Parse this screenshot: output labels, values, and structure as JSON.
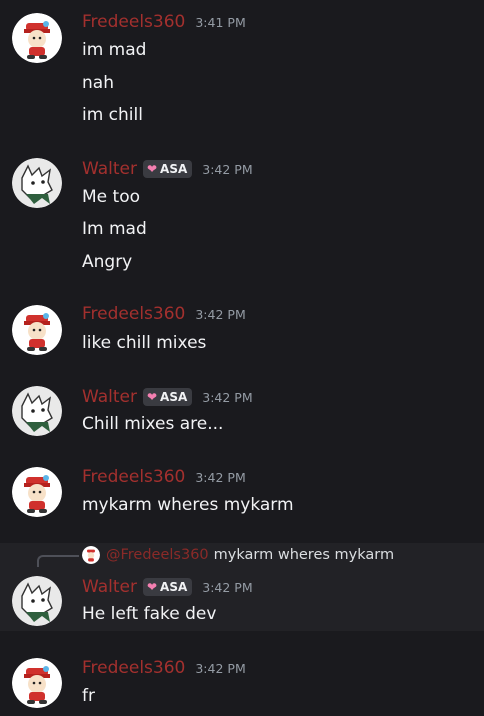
{
  "messages": [
    {
      "author": "Fredeels360",
      "time": "3:41 PM",
      "lines": [
        "im mad",
        "nah",
        "im chill"
      ]
    },
    {
      "author": "Walter",
      "tag": "ASA",
      "time": "3:42 PM",
      "lines": [
        "Me too",
        "Im mad",
        "Angry"
      ]
    },
    {
      "author": "Fredeels360",
      "time": "3:42 PM",
      "lines": [
        "like chill mixes"
      ]
    },
    {
      "author": "Walter",
      "tag": "ASA",
      "time": "3:42 PM",
      "lines": [
        "Chill mixes are..."
      ]
    },
    {
      "author": "Fredeels360",
      "time": "3:42 PM",
      "lines": [
        "mykarm wheres mykarm"
      ]
    },
    {
      "author": "Walter",
      "tag": "ASA",
      "time": "3:42 PM",
      "lines": [
        "He left fake dev"
      ],
      "reply": {
        "author": "@Fredeels360",
        "text": "mykarm wheres mykarm"
      }
    },
    {
      "author": "Fredeels360",
      "time": "3:42 PM",
      "lines": [
        "fr"
      ]
    }
  ],
  "colors": {
    "background": "#1a1a1e",
    "username": "#a3302e",
    "timestamp": "#949ba4",
    "text": "#f2f3f5",
    "tag_heart": "#f47fb1"
  },
  "icons": {
    "fredeels_avatar": "cartoon-boy-red-cap-avatar",
    "walter_avatar": "white-cartoon-cat-avatar",
    "tag_icon": "pink-heart-icon"
  }
}
